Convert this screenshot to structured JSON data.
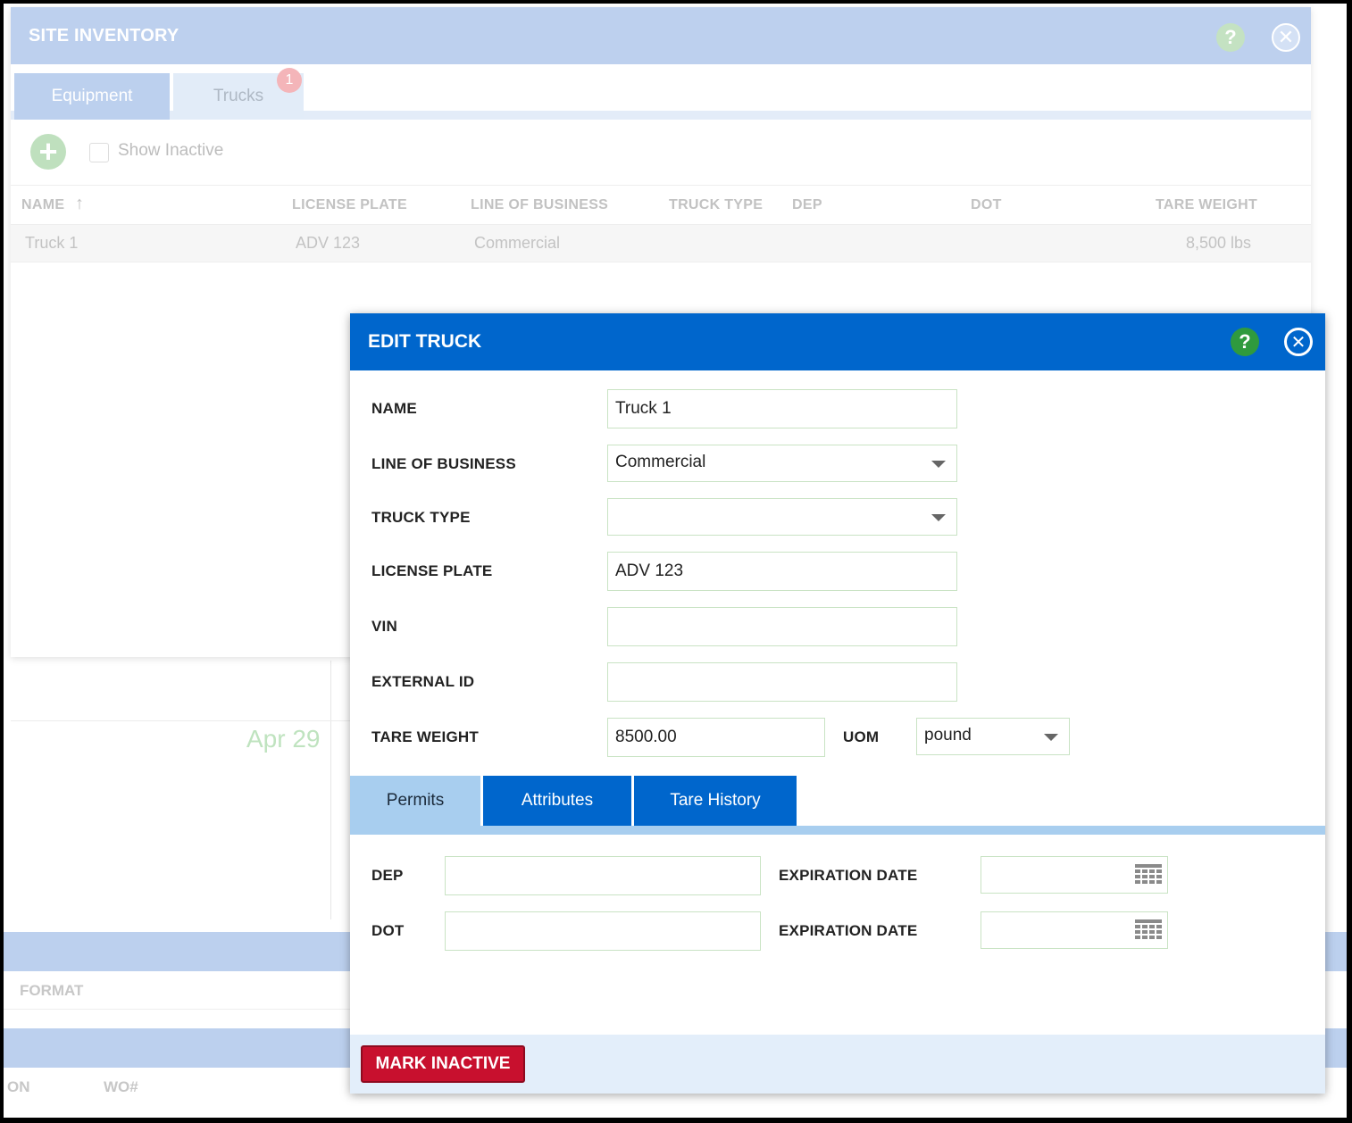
{
  "background": {
    "date_label": "Apr 29",
    "format_label": "FORMAT",
    "col_on": "ON",
    "col_wo": "WO#"
  },
  "site_inventory": {
    "title": "SITE INVENTORY",
    "help_glyph": "?",
    "close_glyph": "✕",
    "tabs": [
      {
        "label": "Equipment"
      },
      {
        "label": "Trucks",
        "badge": "1"
      }
    ],
    "add_glyph": "+",
    "show_inactive_label": "Show Inactive",
    "columns": [
      "NAME",
      "LICENSE PLATE",
      "LINE OF BUSINESS",
      "TRUCK TYPE",
      "DEP",
      "DOT",
      "TARE WEIGHT"
    ],
    "sort_glyph": "↑",
    "rows": [
      {
        "name": "Truck 1",
        "license_plate": "ADV 123",
        "line_of_business": "Commercial",
        "truck_type": "",
        "dep": "",
        "dot": "",
        "tare_weight": "8,500 lbs"
      }
    ]
  },
  "edit_truck": {
    "title": "EDIT TRUCK",
    "help_glyph": "?",
    "close_glyph": "✕",
    "fields": {
      "name_label": "NAME",
      "name_value": "Truck 1",
      "lob_label": "LINE OF BUSINESS",
      "lob_value": "Commercial",
      "truck_type_label": "TRUCK TYPE",
      "truck_type_value": "",
      "license_label": "LICENSE PLATE",
      "license_value": "ADV 123",
      "vin_label": "VIN",
      "vin_value": "",
      "external_id_label": "EXTERNAL ID",
      "external_id_value": "",
      "tare_label": "TARE WEIGHT",
      "tare_value": "8500.00",
      "uom_label": "UOM",
      "uom_value": "pound"
    },
    "sub_tabs": [
      {
        "label": "Permits",
        "active": true
      },
      {
        "label": "Attributes",
        "active": false
      },
      {
        "label": "Tare History",
        "active": false
      }
    ],
    "permits": {
      "dep_label": "DEP",
      "dep_value": "",
      "dep_exp_label": "EXPIRATION DATE",
      "dot_label": "DOT",
      "dot_value": "",
      "dot_exp_label": "EXPIRATION DATE"
    },
    "mark_inactive_label": "MARK INACTIVE"
  },
  "colors": {
    "primary": "#0066cc",
    "danger": "#c8102e",
    "help_green": "#2f9a3e"
  }
}
